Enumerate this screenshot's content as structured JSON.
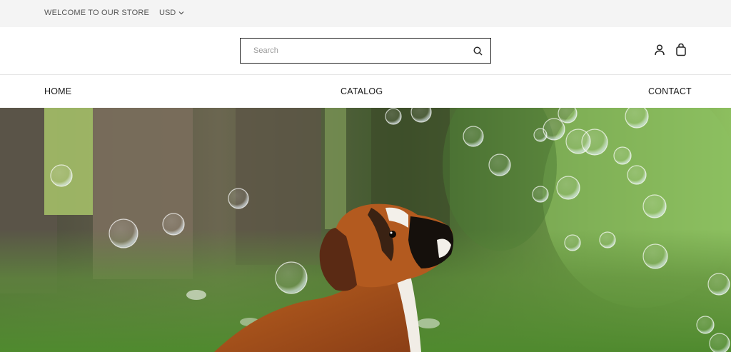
{
  "announcement": {
    "welcome_text": "WELCOME TO OUR STORE",
    "currency": "USD",
    "currency_icon": "chevron-down-icon"
  },
  "header": {
    "search": {
      "placeholder": "Search",
      "value": "",
      "icon": "search-icon"
    },
    "account_icon": "user-icon",
    "cart_icon": "shopping-bag-icon"
  },
  "nav": {
    "items": [
      {
        "label": "HOME"
      },
      {
        "label": "CATALOG"
      },
      {
        "label": "CONTACT"
      }
    ]
  },
  "hero": {
    "image_subject": "boxer dog in forest with soap bubbles",
    "colors": {
      "forest_green": "#5c8c3a",
      "dog_brown": "#a8501e",
      "bark": "#5e5346"
    }
  }
}
